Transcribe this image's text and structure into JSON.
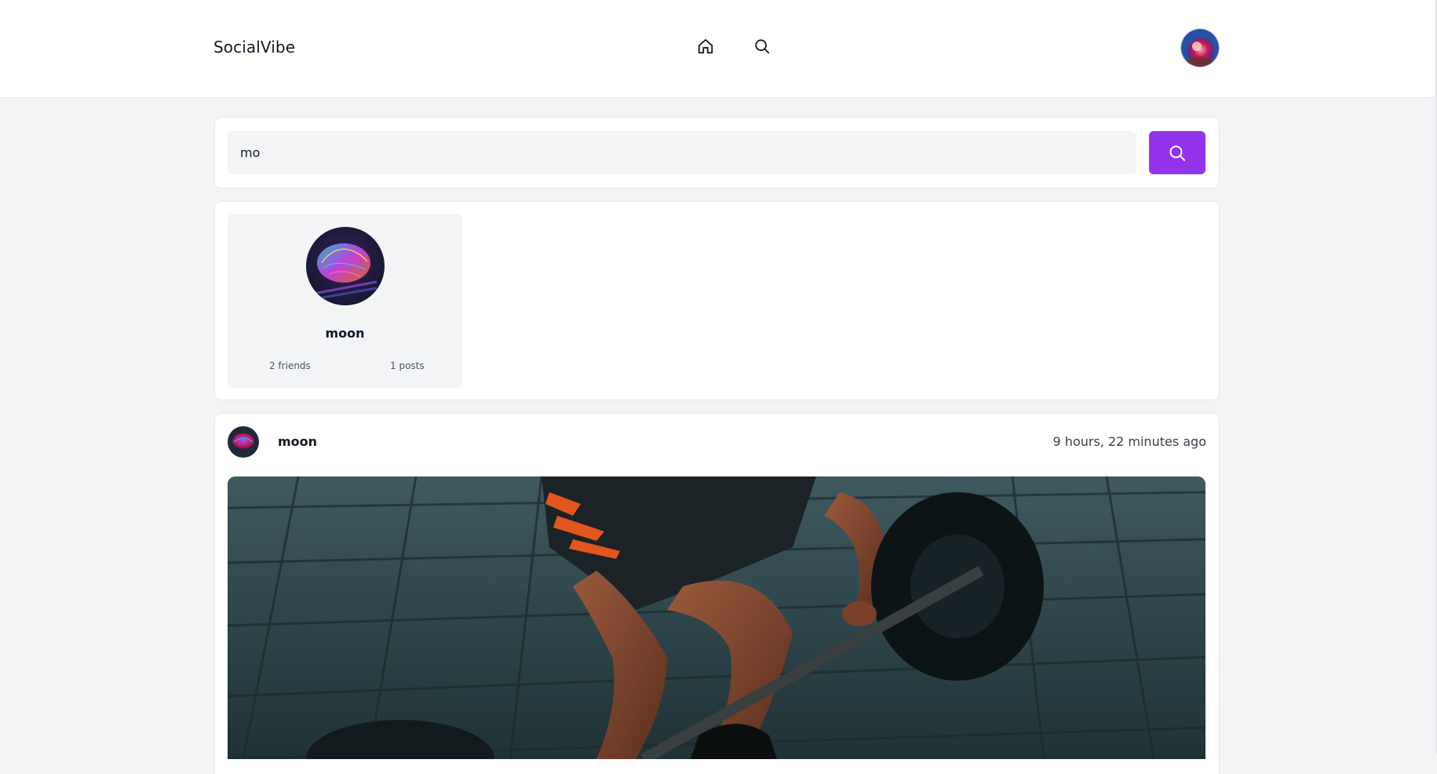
{
  "header": {
    "brand": "SocialVibe",
    "nav": [
      {
        "name": "home",
        "icon": "home-icon"
      },
      {
        "name": "search",
        "icon": "search-icon"
      }
    ],
    "avatar_icon": "user-avatar"
  },
  "search": {
    "value": "mo",
    "button_icon": "search-icon",
    "button_color": "#9333ea"
  },
  "results": [
    {
      "username": "moon",
      "friends": "2 friends",
      "posts": "1 posts"
    }
  ],
  "post": {
    "author": "moon",
    "time": "9 hours, 22 minutes ago",
    "image": "photo of person lifting barbell"
  },
  "colors": {
    "accent": "#9333ea",
    "background": "#f3f4f6",
    "card": "#ffffff"
  }
}
